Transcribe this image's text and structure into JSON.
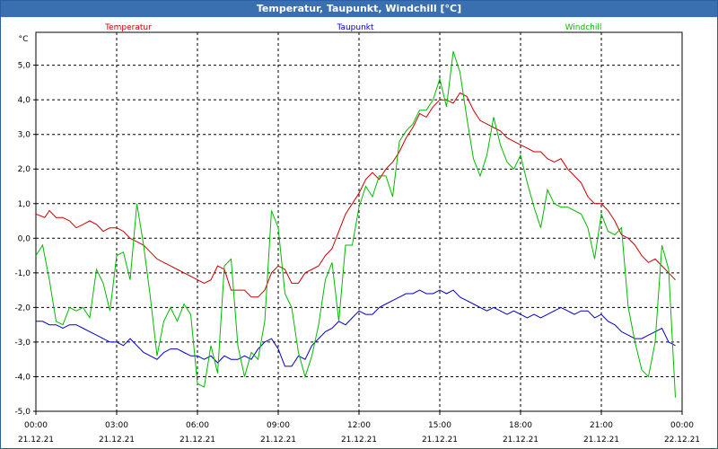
{
  "window": {
    "title": "Temperatur, Taupunkt, Windchill [°C]"
  },
  "chart_data": {
    "type": "line",
    "title": "Temperatur, Taupunkt, Windchill [°C]",
    "ylabel": "°C",
    "ylim": [
      -5,
      6
    ],
    "xlim": [
      0,
      24
    ],
    "grid": true,
    "legend_placement": "top",
    "y_ticks": [
      "5,0",
      "4,0",
      "3,0",
      "2,0",
      "1,0",
      "0,0",
      "-1,0",
      "-2,0",
      "-3,0",
      "-4,0",
      "-5,0"
    ],
    "x_ticks": [
      {
        "time": "00:00",
        "date": "21.12.21"
      },
      {
        "time": "03:00",
        "date": "21.12.21"
      },
      {
        "time": "06:00",
        "date": "21.12.21"
      },
      {
        "time": "09:00",
        "date": "21.12.21"
      },
      {
        "time": "12:00",
        "date": "21.12.21"
      },
      {
        "time": "15:00",
        "date": "21.12.21"
      },
      {
        "time": "18:00",
        "date": "21.12.21"
      },
      {
        "time": "21:00",
        "date": "21.12.21"
      },
      {
        "time": "00:00",
        "date": "22.12.21"
      }
    ],
    "series": [
      {
        "name": "Temperatur",
        "color": "#cc0000",
        "points": [
          [
            0,
            0.7
          ],
          [
            0.33,
            0.6
          ],
          [
            0.5,
            0.8
          ],
          [
            0.75,
            0.6
          ],
          [
            1,
            0.6
          ],
          [
            1.25,
            0.5
          ],
          [
            1.5,
            0.3
          ],
          [
            1.75,
            0.4
          ],
          [
            2,
            0.5
          ],
          [
            2.25,
            0.4
          ],
          [
            2.5,
            0.2
          ],
          [
            2.75,
            0.3
          ],
          [
            3,
            0.3
          ],
          [
            3.25,
            0.2
          ],
          [
            3.5,
            0.0
          ],
          [
            3.75,
            -0.1
          ],
          [
            4,
            -0.2
          ],
          [
            4.25,
            -0.4
          ],
          [
            4.5,
            -0.6
          ],
          [
            4.75,
            -0.7
          ],
          [
            5,
            -0.8
          ],
          [
            5.25,
            -0.9
          ],
          [
            5.5,
            -1.0
          ],
          [
            5.75,
            -1.1
          ],
          [
            6,
            -1.2
          ],
          [
            6.25,
            -1.3
          ],
          [
            6.5,
            -1.2
          ],
          [
            6.75,
            -0.8
          ],
          [
            7,
            -0.9
          ],
          [
            7.25,
            -1.5
          ],
          [
            7.5,
            -1.5
          ],
          [
            7.75,
            -1.5
          ],
          [
            8,
            -1.7
          ],
          [
            8.25,
            -1.7
          ],
          [
            8.5,
            -1.5
          ],
          [
            8.75,
            -1.0
          ],
          [
            9,
            -0.8
          ],
          [
            9.25,
            -0.9
          ],
          [
            9.5,
            -1.3
          ],
          [
            9.75,
            -1.3
          ],
          [
            10,
            -1.0
          ],
          [
            10.25,
            -0.9
          ],
          [
            10.5,
            -0.8
          ],
          [
            10.75,
            -0.5
          ],
          [
            11,
            -0.3
          ],
          [
            11.25,
            0.2
          ],
          [
            11.5,
            0.7
          ],
          [
            11.75,
            1.0
          ],
          [
            12,
            1.3
          ],
          [
            12.25,
            1.7
          ],
          [
            12.5,
            1.9
          ],
          [
            12.75,
            1.7
          ],
          [
            13,
            2.0
          ],
          [
            13.25,
            2.2
          ],
          [
            13.5,
            2.5
          ],
          [
            13.75,
            2.9
          ],
          [
            14,
            3.2
          ],
          [
            14.25,
            3.6
          ],
          [
            14.5,
            3.5
          ],
          [
            14.75,
            3.8
          ],
          [
            15,
            4.0
          ],
          [
            15.25,
            4.0
          ],
          [
            15.5,
            3.9
          ],
          [
            15.75,
            4.2
          ],
          [
            16,
            4.1
          ],
          [
            16.25,
            3.7
          ],
          [
            16.5,
            3.4
          ],
          [
            16.75,
            3.3
          ],
          [
            17,
            3.2
          ],
          [
            17.25,
            3.1
          ],
          [
            17.5,
            2.9
          ],
          [
            17.75,
            2.8
          ],
          [
            18,
            2.7
          ],
          [
            18.25,
            2.6
          ],
          [
            18.5,
            2.5
          ],
          [
            18.75,
            2.5
          ],
          [
            19,
            2.3
          ],
          [
            19.25,
            2.2
          ],
          [
            19.5,
            2.3
          ],
          [
            19.75,
            2.0
          ],
          [
            20,
            1.8
          ],
          [
            20.25,
            1.6
          ],
          [
            20.5,
            1.2
          ],
          [
            20.75,
            1.0
          ],
          [
            21,
            1.0
          ],
          [
            21.25,
            0.8
          ],
          [
            21.5,
            0.5
          ],
          [
            21.75,
            0.1
          ],
          [
            22,
            0.0
          ],
          [
            22.25,
            -0.2
          ],
          [
            22.5,
            -0.5
          ],
          [
            22.75,
            -0.7
          ],
          [
            23,
            -0.6
          ],
          [
            23.25,
            -0.8
          ],
          [
            23.5,
            -1.0
          ],
          [
            23.75,
            -1.2
          ]
        ]
      },
      {
        "name": "Taupunkt",
        "color": "#0000cc",
        "points": [
          [
            0,
            -2.4
          ],
          [
            0.25,
            -2.4
          ],
          [
            0.5,
            -2.5
          ],
          [
            0.75,
            -2.5
          ],
          [
            1,
            -2.6
          ],
          [
            1.25,
            -2.5
          ],
          [
            1.5,
            -2.5
          ],
          [
            1.75,
            -2.6
          ],
          [
            2,
            -2.7
          ],
          [
            2.25,
            -2.8
          ],
          [
            2.5,
            -2.9
          ],
          [
            2.75,
            -3.0
          ],
          [
            3,
            -3.0
          ],
          [
            3.25,
            -3.1
          ],
          [
            3.5,
            -2.9
          ],
          [
            3.75,
            -3.1
          ],
          [
            4,
            -3.3
          ],
          [
            4.25,
            -3.4
          ],
          [
            4.5,
            -3.5
          ],
          [
            4.75,
            -3.3
          ],
          [
            5,
            -3.2
          ],
          [
            5.25,
            -3.2
          ],
          [
            5.5,
            -3.3
          ],
          [
            5.75,
            -3.4
          ],
          [
            6,
            -3.4
          ],
          [
            6.25,
            -3.5
          ],
          [
            6.5,
            -3.4
          ],
          [
            6.75,
            -3.6
          ],
          [
            7,
            -3.4
          ],
          [
            7.25,
            -3.5
          ],
          [
            7.5,
            -3.5
          ],
          [
            7.75,
            -3.4
          ],
          [
            8,
            -3.5
          ],
          [
            8.25,
            -3.2
          ],
          [
            8.5,
            -3.0
          ],
          [
            8.75,
            -2.9
          ],
          [
            9,
            -3.2
          ],
          [
            9.25,
            -3.7
          ],
          [
            9.5,
            -3.7
          ],
          [
            9.75,
            -3.4
          ],
          [
            10,
            -3.5
          ],
          [
            10.25,
            -3.1
          ],
          [
            10.5,
            -2.9
          ],
          [
            10.75,
            -2.7
          ],
          [
            11,
            -2.6
          ],
          [
            11.25,
            -2.4
          ],
          [
            11.5,
            -2.5
          ],
          [
            11.75,
            -2.3
          ],
          [
            12,
            -2.1
          ],
          [
            12.25,
            -2.2
          ],
          [
            12.5,
            -2.2
          ],
          [
            12.75,
            -2.0
          ],
          [
            13,
            -1.9
          ],
          [
            13.25,
            -1.8
          ],
          [
            13.5,
            -1.7
          ],
          [
            13.75,
            -1.6
          ],
          [
            14,
            -1.6
          ],
          [
            14.25,
            -1.5
          ],
          [
            14.5,
            -1.6
          ],
          [
            14.75,
            -1.6
          ],
          [
            15,
            -1.5
          ],
          [
            15.25,
            -1.6
          ],
          [
            15.5,
            -1.5
          ],
          [
            15.75,
            -1.7
          ],
          [
            16,
            -1.8
          ],
          [
            16.25,
            -1.9
          ],
          [
            16.5,
            -2.0
          ],
          [
            16.75,
            -2.1
          ],
          [
            17,
            -2.0
          ],
          [
            17.25,
            -2.1
          ],
          [
            17.5,
            -2.2
          ],
          [
            17.75,
            -2.1
          ],
          [
            18,
            -2.2
          ],
          [
            18.25,
            -2.3
          ],
          [
            18.5,
            -2.2
          ],
          [
            18.75,
            -2.3
          ],
          [
            19,
            -2.2
          ],
          [
            19.25,
            -2.1
          ],
          [
            19.5,
            -2.0
          ],
          [
            19.75,
            -2.1
          ],
          [
            20,
            -2.2
          ],
          [
            20.25,
            -2.1
          ],
          [
            20.5,
            -2.1
          ],
          [
            20.75,
            -2.3
          ],
          [
            21,
            -2.2
          ],
          [
            21.25,
            -2.4
          ],
          [
            21.5,
            -2.5
          ],
          [
            21.75,
            -2.7
          ],
          [
            22,
            -2.8
          ],
          [
            22.25,
            -2.9
          ],
          [
            22.5,
            -2.9
          ],
          [
            22.75,
            -2.8
          ],
          [
            23,
            -2.7
          ],
          [
            23.25,
            -2.6
          ],
          [
            23.5,
            -3.0
          ],
          [
            23.75,
            -3.1
          ]
        ]
      },
      {
        "name": "Windchill",
        "color": "#00bb00",
        "points": [
          [
            0,
            -0.5
          ],
          [
            0.25,
            -0.2
          ],
          [
            0.5,
            -1.2
          ],
          [
            0.75,
            -2.4
          ],
          [
            1,
            -2.5
          ],
          [
            1.25,
            -2.0
          ],
          [
            1.5,
            -2.1
          ],
          [
            1.75,
            -2.0
          ],
          [
            2,
            -2.3
          ],
          [
            2.25,
            -0.9
          ],
          [
            2.5,
            -1.3
          ],
          [
            2.75,
            -2.1
          ],
          [
            3,
            -0.5
          ],
          [
            3.25,
            -0.4
          ],
          [
            3.5,
            -1.2
          ],
          [
            3.75,
            1.0
          ],
          [
            4,
            -0.2
          ],
          [
            4.25,
            -1.7
          ],
          [
            4.5,
            -3.4
          ],
          [
            4.75,
            -2.4
          ],
          [
            5,
            -2.0
          ],
          [
            5.25,
            -2.4
          ],
          [
            5.5,
            -1.9
          ],
          [
            5.75,
            -2.2
          ],
          [
            6,
            -4.2
          ],
          [
            6.25,
            -4.3
          ],
          [
            6.5,
            -3.1
          ],
          [
            6.75,
            -3.9
          ],
          [
            7,
            -0.8
          ],
          [
            7.25,
            -0.6
          ],
          [
            7.5,
            -3.1
          ],
          [
            7.75,
            -4.0
          ],
          [
            8,
            -3.3
          ],
          [
            8.25,
            -3.5
          ],
          [
            8.5,
            -2.4
          ],
          [
            8.75,
            0.8
          ],
          [
            9,
            0.3
          ],
          [
            9.25,
            -1.6
          ],
          [
            9.5,
            -2.0
          ],
          [
            9.75,
            -3.3
          ],
          [
            10,
            -4.0
          ],
          [
            10.25,
            -3.4
          ],
          [
            10.5,
            -2.5
          ],
          [
            10.75,
            -1.2
          ],
          [
            11,
            -0.7
          ],
          [
            11.25,
            -2.4
          ],
          [
            11.5,
            -0.2
          ],
          [
            11.75,
            -0.2
          ],
          [
            12,
            0.9
          ],
          [
            12.25,
            1.5
          ],
          [
            12.5,
            1.2
          ],
          [
            12.75,
            1.8
          ],
          [
            13,
            1.8
          ],
          [
            13.25,
            1.2
          ],
          [
            13.5,
            2.8
          ],
          [
            13.75,
            3.1
          ],
          [
            14,
            3.3
          ],
          [
            14.25,
            3.7
          ],
          [
            14.5,
            3.7
          ],
          [
            14.75,
            4.0
          ],
          [
            15,
            4.6
          ],
          [
            15.25,
            3.8
          ],
          [
            15.5,
            5.4
          ],
          [
            15.75,
            4.8
          ],
          [
            16,
            3.5
          ],
          [
            16.25,
            2.3
          ],
          [
            16.5,
            1.8
          ],
          [
            16.75,
            2.4
          ],
          [
            17,
            3.5
          ],
          [
            17.25,
            2.7
          ],
          [
            17.5,
            2.2
          ],
          [
            17.75,
            2.0
          ],
          [
            18,
            2.4
          ],
          [
            18.25,
            1.6
          ],
          [
            18.5,
            0.9
          ],
          [
            18.75,
            0.3
          ],
          [
            19,
            1.4
          ],
          [
            19.25,
            1.0
          ],
          [
            19.5,
            0.9
          ],
          [
            19.75,
            0.9
          ],
          [
            20,
            0.8
          ],
          [
            20.25,
            0.7
          ],
          [
            20.5,
            0.3
          ],
          [
            20.75,
            -0.6
          ],
          [
            21,
            0.7
          ],
          [
            21.25,
            0.2
          ],
          [
            21.5,
            0.1
          ],
          [
            21.75,
            0.3
          ],
          [
            22,
            -2.0
          ],
          [
            22.25,
            -3.0
          ],
          [
            22.5,
            -3.8
          ],
          [
            22.75,
            -4.0
          ],
          [
            23,
            -3.0
          ],
          [
            23.25,
            -0.2
          ],
          [
            23.5,
            -0.9
          ],
          [
            23.75,
            -4.6
          ]
        ]
      }
    ]
  }
}
